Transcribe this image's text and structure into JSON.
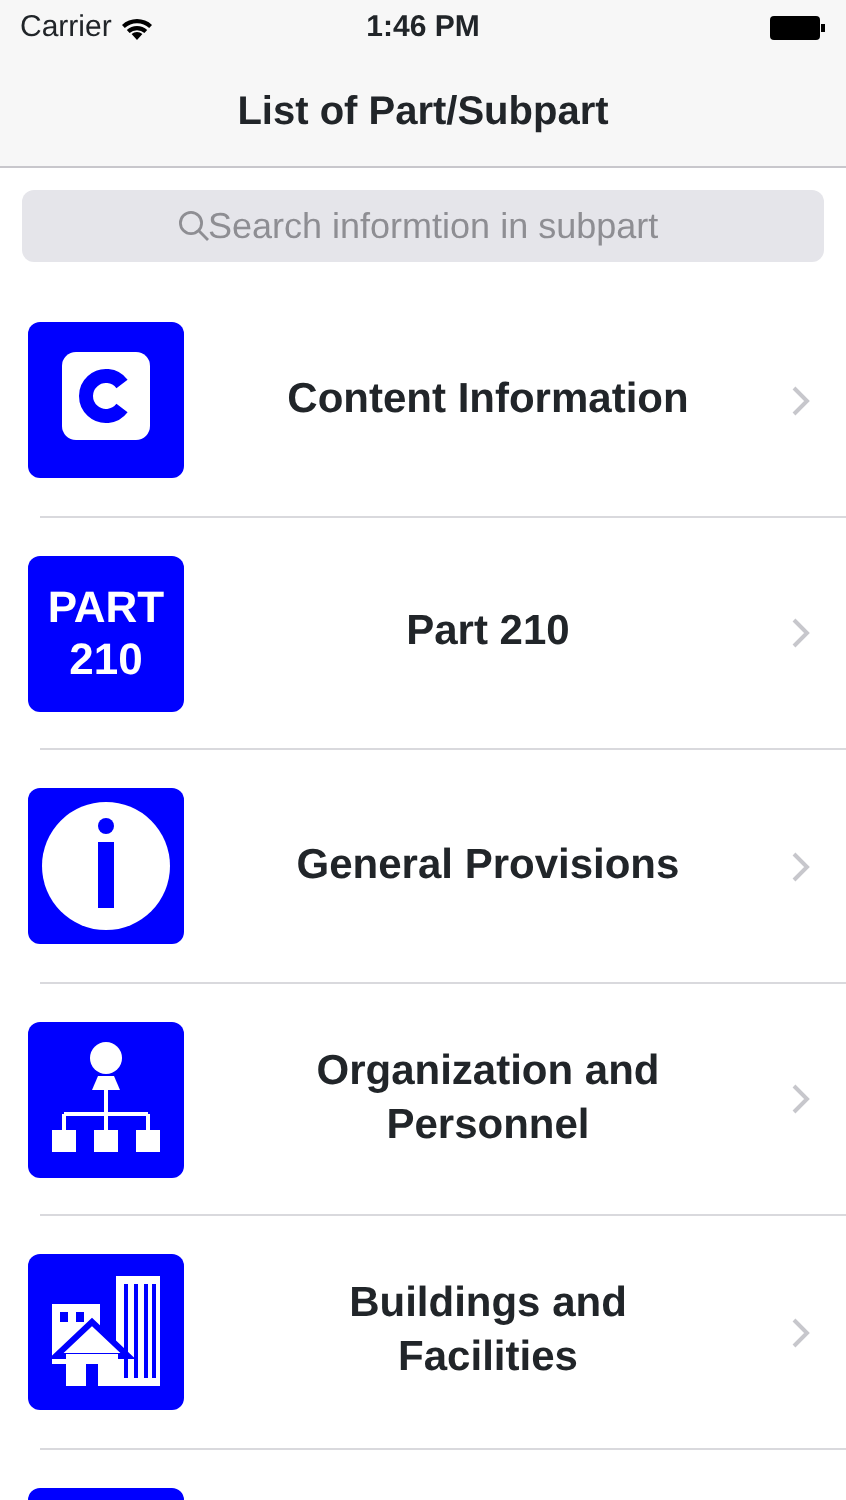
{
  "status_bar": {
    "carrier": "Carrier",
    "time": "1:46 PM"
  },
  "nav_bar": {
    "title": "List of Part/Subpart"
  },
  "search": {
    "placeholder": "Search informtion in subpart"
  },
  "items": [
    {
      "kind": "c",
      "label": "Content Information"
    },
    {
      "kind": "part",
      "icon_text": [
        "PART",
        "210"
      ],
      "label": "Part 210"
    },
    {
      "kind": "info",
      "label": "General Provisions"
    },
    {
      "kind": "org",
      "label": "Organization and Personnel"
    },
    {
      "kind": "building",
      "label": "Buildings and Facilities"
    },
    {
      "kind": "blank"
    }
  ]
}
